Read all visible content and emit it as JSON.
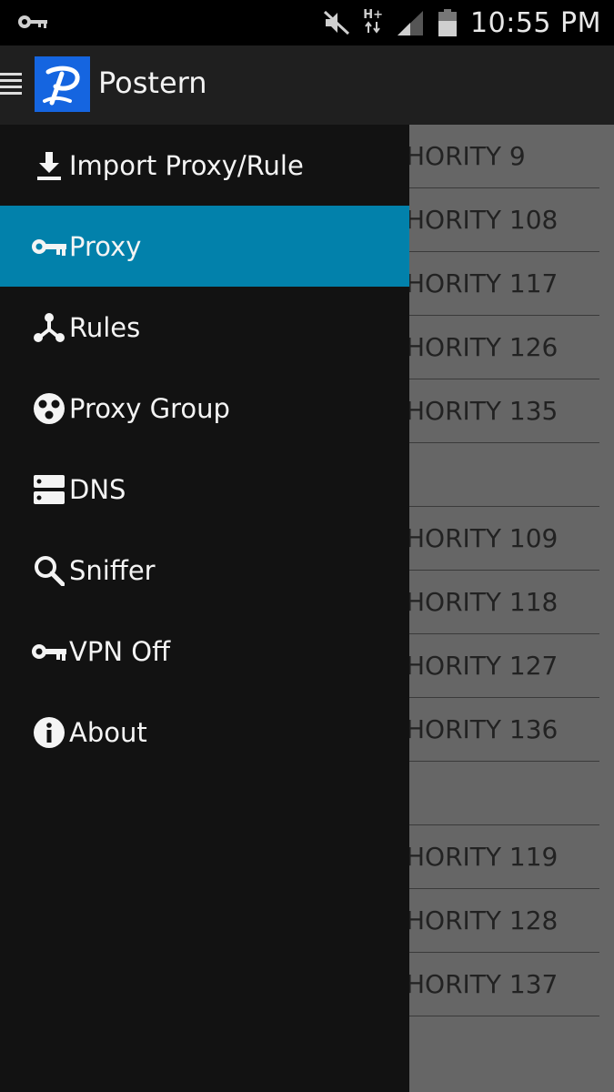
{
  "status_bar": {
    "time": "10:55 PM",
    "network_type": "H+",
    "icons": [
      "vpn-key-icon",
      "mute-icon",
      "data-transfer-icon",
      "signal-icon",
      "battery-icon"
    ]
  },
  "action_bar": {
    "title": "Postern",
    "logo_letter": "P",
    "logo_color": "#1565e0"
  },
  "drawer": {
    "accent_color": "#0281ab",
    "items": [
      {
        "label": "Import Proxy/Rule",
        "icon": "download-icon",
        "active": false
      },
      {
        "label": "Proxy",
        "icon": "key-icon",
        "active": true
      },
      {
        "label": "Rules",
        "icon": "rules-fork-icon",
        "active": false
      },
      {
        "label": "Proxy Group",
        "icon": "group-circles-icon",
        "active": false
      },
      {
        "label": "DNS",
        "icon": "dns-server-icon",
        "active": false
      },
      {
        "label": "Sniffer",
        "icon": "search-icon",
        "active": false
      },
      {
        "label": "VPN Off",
        "icon": "key-icon",
        "active": false
      },
      {
        "label": "About",
        "icon": "info-icon",
        "active": false
      }
    ]
  },
  "background_list": {
    "rows": [
      "HORITY 9",
      "HORITY 108",
      "HORITY 117",
      "HORITY 126",
      "HORITY 135",
      "",
      "HORITY 109",
      "HORITY 118",
      "HORITY 127",
      "HORITY 136",
      "",
      "HORITY 119",
      "HORITY 128",
      "HORITY 137"
    ]
  }
}
